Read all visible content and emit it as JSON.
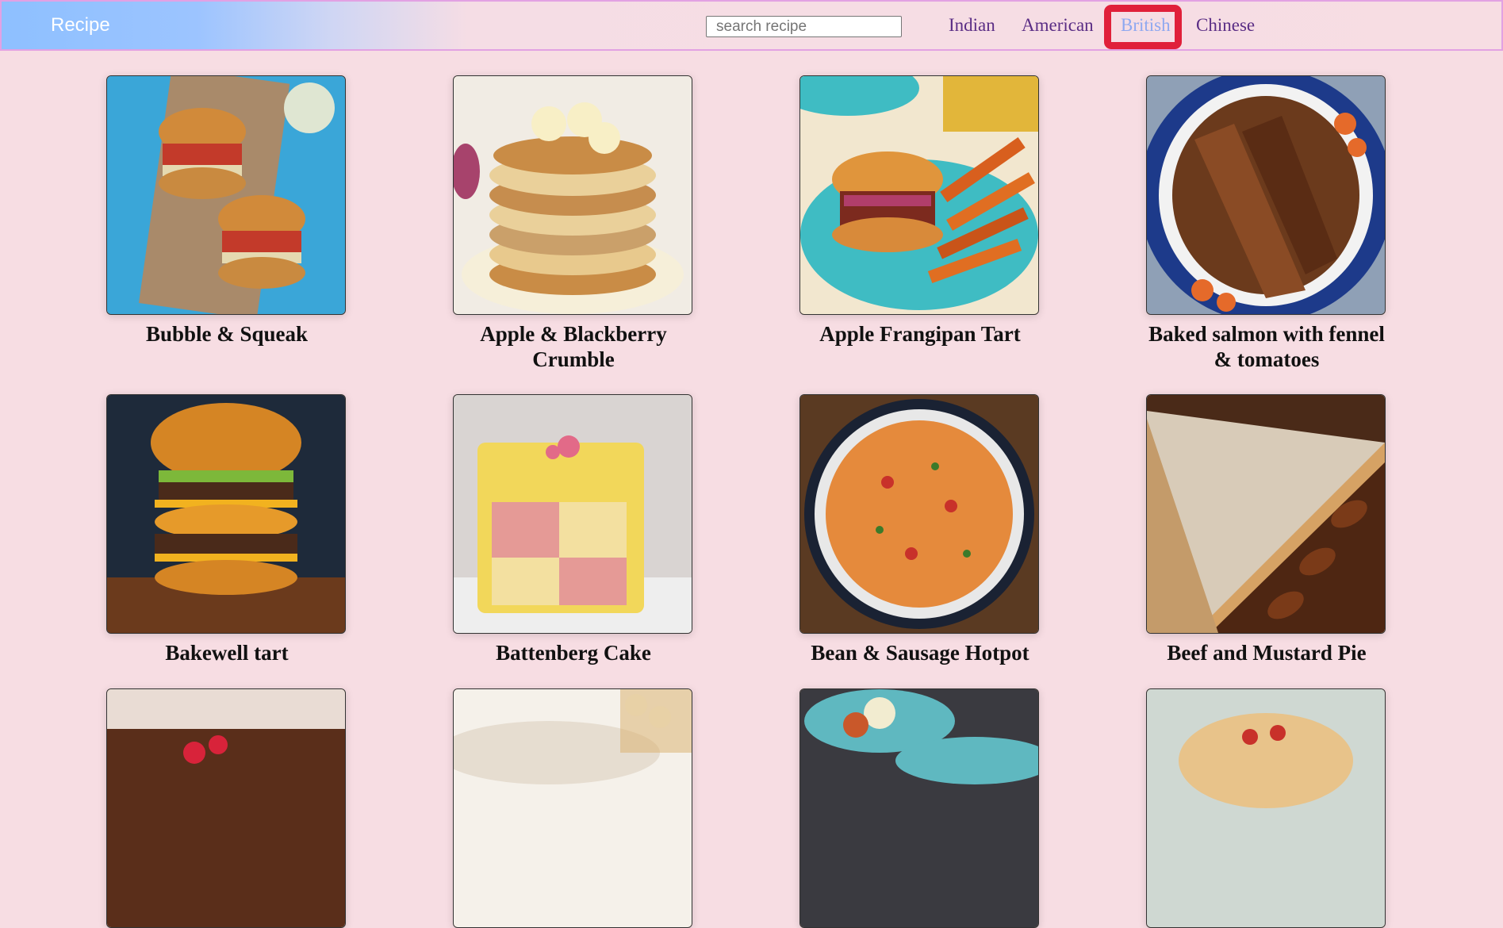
{
  "navbar": {
    "brand": "Recipe",
    "search_placeholder": "search recipe",
    "links": [
      {
        "label": "Indian",
        "active": false
      },
      {
        "label": "American",
        "active": false
      },
      {
        "label": "British",
        "active": true
      },
      {
        "label": "Chinese",
        "active": false
      }
    ]
  },
  "recipes": [
    {
      "title": "Bubble & Squeak",
      "image": "burger-with-slaw-photo"
    },
    {
      "title": "Apple & Blackberry Crumble",
      "image": "banana-pancake-stack-photo"
    },
    {
      "title": "Apple Frangipan Tart",
      "image": "burger-with-sweet-potato-fries-photo"
    },
    {
      "title": "Baked salmon with fennel & tomatoes",
      "image": "sliced-roast-beef-photo"
    },
    {
      "title": "Bakewell tart",
      "image": "double-cheeseburger-photo"
    },
    {
      "title": "Battenberg Cake",
      "image": "battenberg-cake-photo"
    },
    {
      "title": "Bean & Sausage Hotpot",
      "image": "pasta-bowl-photo"
    },
    {
      "title": "Beef and Mustard Pie",
      "image": "pecan-pie-photo"
    },
    {
      "title": "",
      "image": "brownie-with-raspberries-photo"
    },
    {
      "title": "",
      "image": "bowl-with-white-chocolate-photo"
    },
    {
      "title": "",
      "image": "cauliflower-plate-photo"
    },
    {
      "title": "",
      "image": "pastry-with-berries-photo"
    }
  ],
  "colors": {
    "background": "#f7dde3",
    "nav_link": "#5a2d85",
    "nav_link_active": "#8ea8f0",
    "highlight": "#e0203a"
  }
}
